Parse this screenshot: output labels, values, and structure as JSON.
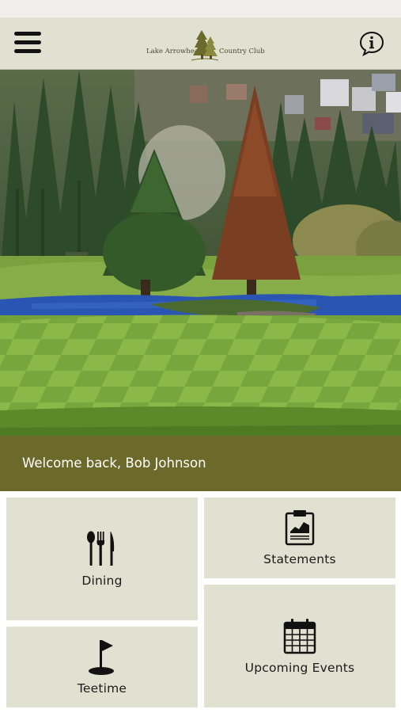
{
  "header": {
    "logo_left": "Lake Arrowhead",
    "logo_right": "Country Club",
    "menu_icon": "hamburger-menu-icon",
    "info_icon": "info-speech-bubble-icon"
  },
  "welcome": {
    "text": "Welcome back, Bob Johnson"
  },
  "tiles": {
    "dining": {
      "label": "Dining",
      "icon": "cutlery-icon"
    },
    "statements": {
      "label": "Statements",
      "icon": "clipboard-chart-icon"
    },
    "teetime": {
      "label": "Teetime",
      "icon": "golf-flag-icon"
    },
    "events": {
      "label": "Upcoming Events",
      "icon": "calendar-icon"
    }
  },
  "colors": {
    "header_bg": "#e0e1d0",
    "welcome_bg": "#6c6a2a",
    "tile_bg": "#e0e1d0"
  }
}
